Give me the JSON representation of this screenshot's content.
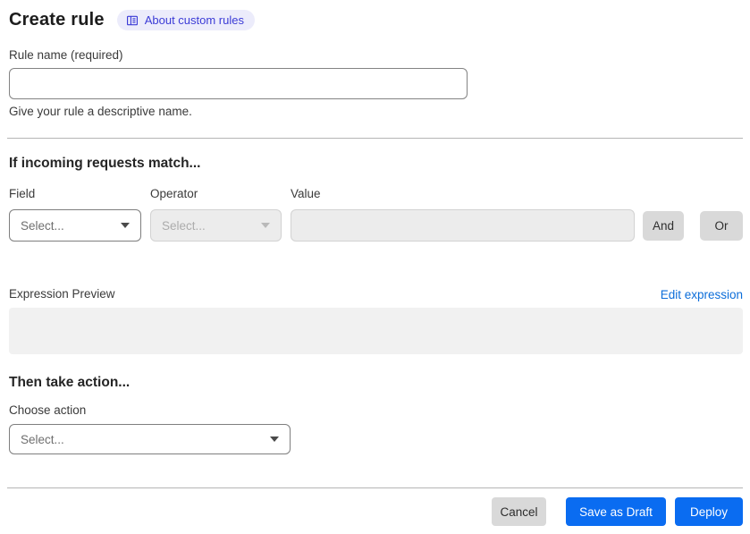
{
  "page": {
    "title": "Create rule",
    "about_badge": "About custom rules"
  },
  "rule_name": {
    "label": "Rule name (required)",
    "value": "",
    "helper": "Give your rule a descriptive name."
  },
  "match": {
    "heading": "If incoming requests match...",
    "field_label": "Field",
    "field_placeholder": "Select...",
    "operator_label": "Operator",
    "operator_placeholder": "Select...",
    "value_label": "Value",
    "value": "",
    "and_label": "And",
    "or_label": "Or",
    "preview_label": "Expression Preview",
    "edit_link": "Edit expression",
    "expression": ""
  },
  "action": {
    "heading": "Then take action...",
    "choose_label": "Choose action",
    "placeholder": "Select..."
  },
  "footer": {
    "cancel": "Cancel",
    "save_draft": "Save as Draft",
    "deploy": "Deploy"
  },
  "icons": {
    "badge_icon": "book-icon",
    "select_icon": "chevron-down-icon"
  },
  "colors": {
    "primary_button": "#0a6cf1",
    "link": "#0b6dd9",
    "badge_bg": "#ececfb",
    "badge_text": "#3b3bd6",
    "divider": "#b5b5b5",
    "disabled_bg": "#ececec",
    "grey_button": "#d9d9d9"
  }
}
